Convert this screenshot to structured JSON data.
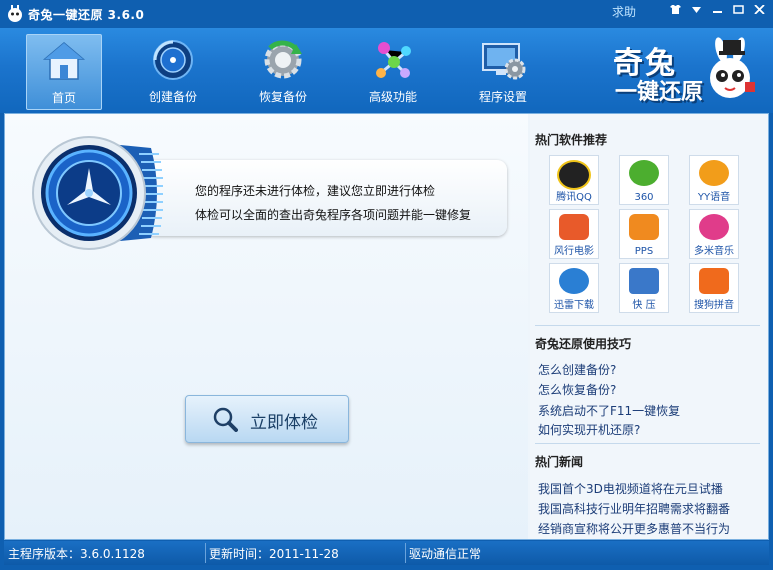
{
  "window": {
    "title": "奇兔一键还原 3.6.0",
    "help": "求助"
  },
  "toolbar": [
    {
      "label": "首页",
      "icon": "home-icon",
      "active": true
    },
    {
      "label": "创建备份",
      "icon": "create-backup-icon",
      "active": false
    },
    {
      "label": "恢复备份",
      "icon": "restore-backup-icon",
      "active": false
    },
    {
      "label": "高级功能",
      "icon": "advanced-icon",
      "active": false
    },
    {
      "label": "程序设置",
      "icon": "settings-icon",
      "active": false
    }
  ],
  "brand": {
    "line1": "奇兔",
    "line2": "一键还原"
  },
  "main": {
    "notice_line1": "您的程序还未进行体检，建议您立即进行体检",
    "notice_line2": "体检可以全面的查出奇兔程序各项问题并能一键修复",
    "scan_button": "立即体检"
  },
  "sidebar": {
    "hot_software_title": "热门软件推荐",
    "software": [
      {
        "name": "腾讯QQ",
        "color": "#f0c419"
      },
      {
        "name": "360",
        "color": "#4cae2f"
      },
      {
        "name": "YY语音",
        "color": "#f29d1a"
      },
      {
        "name": "风行电影",
        "color": "#e85a2a"
      },
      {
        "name": "PPS",
        "color": "#f08a1f"
      },
      {
        "name": "多米音乐",
        "color": "#e03c8a"
      },
      {
        "name": "迅雷下载",
        "color": "#2a7fd4"
      },
      {
        "name": "快 压",
        "color": "#3a78c9"
      },
      {
        "name": "搜狗拼音",
        "color": "#f06a1c"
      }
    ],
    "tips_title": "奇兔还原使用技巧",
    "tips": [
      "怎么创建备份?",
      "怎么恢复备份?",
      "系统启动不了F11一键恢复",
      "如何实现开机还原?"
    ],
    "news_title": "热门新闻",
    "news": [
      "我国首个3D电视频道将在元旦试播",
      "我国高科技行业明年招聘需求将翻番",
      "经销商宣称将公开更多惠普不当行为"
    ]
  },
  "status": {
    "version": "主程序版本：3.6.0.1128",
    "update": "更新时间：2011-11-28",
    "driver": "驱动通信正常"
  }
}
